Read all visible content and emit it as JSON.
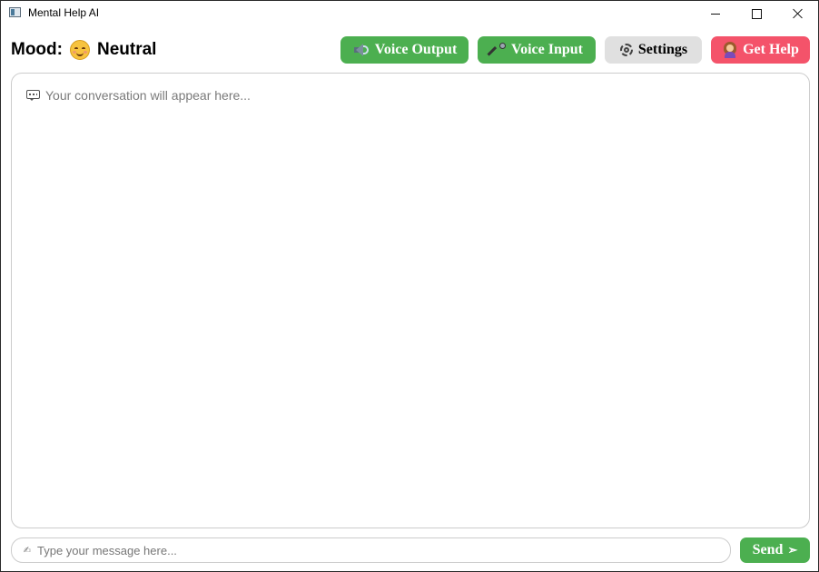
{
  "window": {
    "title": "Mental Help AI",
    "icon": "app-icon",
    "controls": [
      "minimize-icon",
      "maximize-icon",
      "close-icon"
    ]
  },
  "header": {
    "mood_label": "Mood:",
    "mood_icon": "smiling-face-icon",
    "mood_value": "Neutral",
    "buttons": [
      {
        "label": "Voice Output",
        "icon": "speaker-icon",
        "color": "#4caf50"
      },
      {
        "label": "Voice Input",
        "icon": "microphone-icon",
        "color": "#4caf50"
      },
      {
        "label": "Settings",
        "icon": "gear-icon",
        "color": "#e0e0e0"
      },
      {
        "label": "Get Help",
        "icon": "person-raising-hand-icon",
        "color": "#f4536a"
      }
    ]
  },
  "conversation": {
    "placeholder_icon": "speech-bubble-icon",
    "placeholder": "Your conversation will appear here..."
  },
  "composer": {
    "input_icon": "writing-hand-icon",
    "placeholder": "Type your message here...",
    "value": "",
    "send_label": "Send",
    "send_icon": "send-arrow-icon",
    "send_color": "#4caf50"
  }
}
